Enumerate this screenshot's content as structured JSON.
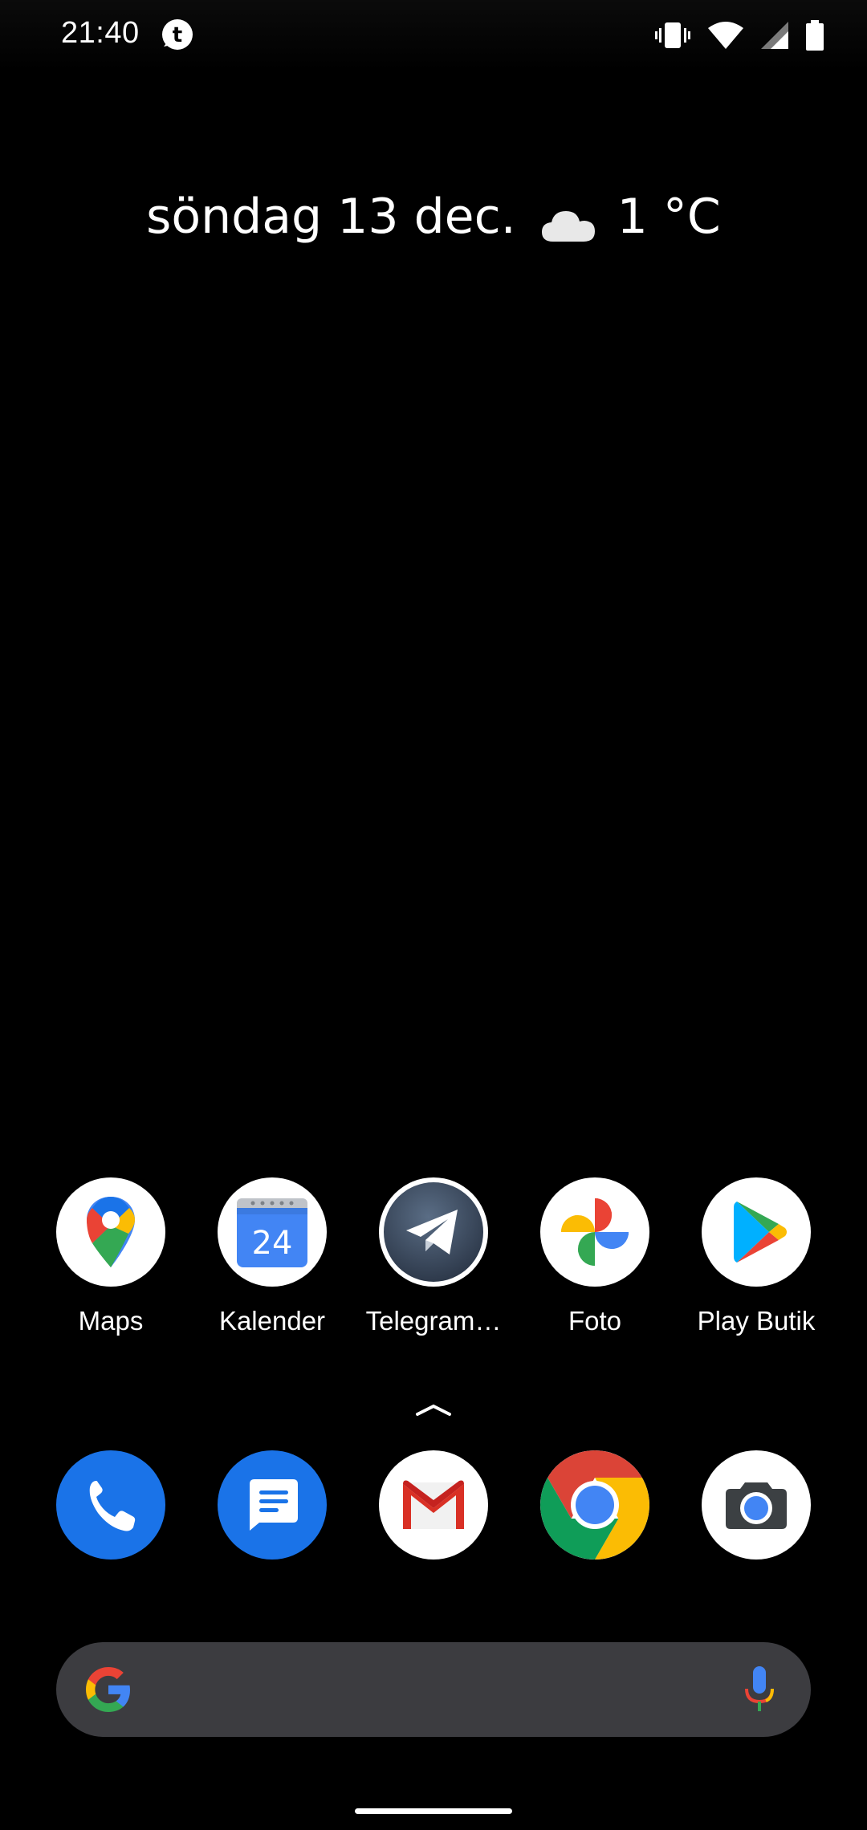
{
  "status_bar": {
    "time": "21:40",
    "icons": [
      "telegram-x-notification-icon",
      "vibrate-icon",
      "wifi-icon",
      "cellular-signal-icon",
      "battery-icon"
    ]
  },
  "at_a_glance": {
    "date": "söndag 13 dec.",
    "weather_icon": "cloud-icon",
    "temperature": "1 °C"
  },
  "home_apps": [
    {
      "label": "Maps",
      "icon": "maps-icon"
    },
    {
      "label": "Kalender",
      "icon": "calendar-icon",
      "icon_text": "24"
    },
    {
      "label": "Telegram…",
      "icon": "telegram-icon"
    },
    {
      "label": "Foto",
      "icon": "photos-icon"
    },
    {
      "label": "Play Butik",
      "icon": "play-store-icon"
    }
  ],
  "dock_apps": [
    {
      "icon": "phone-icon"
    },
    {
      "icon": "messages-icon"
    },
    {
      "icon": "gmail-icon"
    },
    {
      "icon": "chrome-icon"
    },
    {
      "icon": "camera-icon"
    }
  ],
  "search_bar": {
    "left_icon": "google-icon",
    "right_icon": "mic-icon"
  },
  "colors": {
    "background": "#000000",
    "search_bar": "#3c3c40",
    "google_blue": "#4285F4",
    "google_red": "#EA4335",
    "google_yellow": "#FBBC04",
    "google_green": "#34A853",
    "phone_blue": "#1A73E8"
  }
}
